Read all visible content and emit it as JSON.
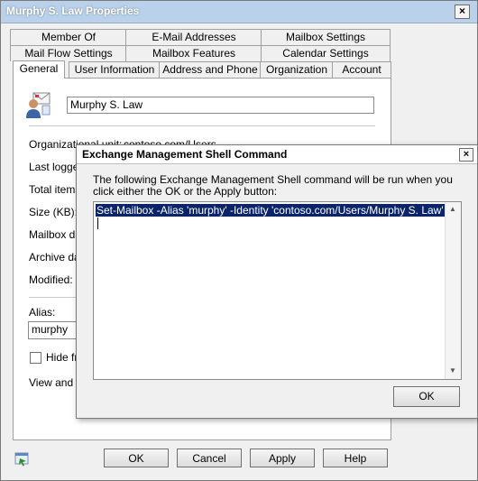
{
  "window": {
    "title": "Murphy S. Law Properties",
    "close_glyph": "×"
  },
  "tabs": {
    "row1": [
      "Member Of",
      "E-Mail Addresses",
      "Mailbox Settings"
    ],
    "row2": [
      "Mail Flow Settings",
      "Mailbox Features",
      "Calendar Settings"
    ],
    "row3": [
      "General",
      "User Information",
      "Address and Phone",
      "Organization",
      "Account"
    ],
    "active": "General"
  },
  "general": {
    "display_name": "Murphy S. Law",
    "org_unit_label": "Organizational unit:",
    "org_unit_value": "contoso.com/Users",
    "last_logged_label": "Last logged",
    "total_items_label": "Total items",
    "size_label": "Size (KB):",
    "mailbox_db_label": "Mailbox dat",
    "archive_db_label": "Archive dat",
    "modified_label": "Modified:",
    "alias_label": "Alias:",
    "alias_value": "murphy",
    "hide_label": "Hide fro",
    "view_label": "View and m"
  },
  "footer": {
    "ok": "OK",
    "cancel": "Cancel",
    "apply": "Apply",
    "help": "Help"
  },
  "dialog": {
    "title": "Exchange Management Shell Command",
    "close_glyph": "×",
    "description": "The following Exchange Management Shell command will be run when you click either the OK or the Apply button:",
    "command": "Set-Mailbox -Alias 'murphy' -Identity 'contoso.com/Users/Murphy S. Law'",
    "ok": "OK"
  },
  "icons": {
    "user": "user-mailbox-icon",
    "footer": "properties-help-icon",
    "scroll_up": "▲",
    "scroll_down": "▼"
  },
  "colors": {
    "titlebar": "#b9d1ea",
    "selection": "#0a246a"
  }
}
